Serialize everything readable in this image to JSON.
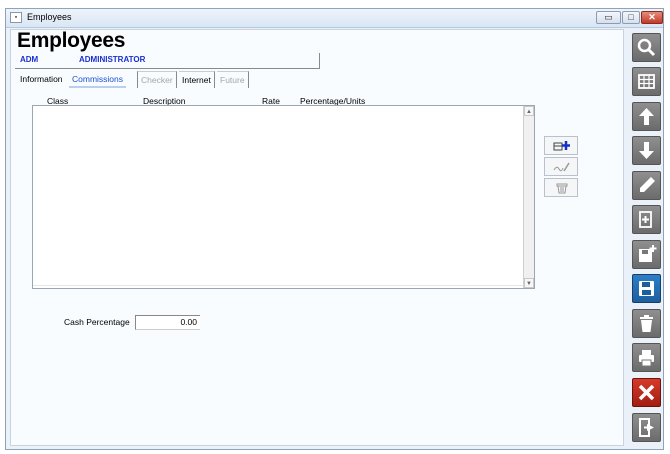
{
  "window": {
    "title": "Employees",
    "icon": "app-icon"
  },
  "heading": "Employees",
  "employee": {
    "code": "ADM",
    "name": "ADMINISTRATOR"
  },
  "tabs": [
    {
      "label": "Information",
      "state": "normal"
    },
    {
      "label": "Commissions",
      "state": "active"
    },
    {
      "label": "Checker",
      "state": "disabled"
    },
    {
      "label": "Internet",
      "state": "normal"
    },
    {
      "label": "Future",
      "state": "disabled"
    }
  ],
  "table": {
    "columns": [
      "Class",
      "Description",
      "Rate",
      "Percentage/Units"
    ],
    "rows": []
  },
  "grid_buttons": [
    "add-row-icon",
    "edit-row-icon",
    "delete-row-icon"
  ],
  "cash": {
    "label": "Cash Percentage",
    "value": "0.00"
  },
  "toolbar": [
    "search-icon",
    "grid-icon",
    "arrow-up-icon",
    "arrow-down-icon",
    "pencil-icon",
    "new-document-icon",
    "save-new-icon",
    "save-icon",
    "trash-icon",
    "print-icon",
    "cancel-icon",
    "exit-icon"
  ],
  "colors": {
    "accent": "#1a2fd0",
    "save": "#1c5f9e",
    "cancel": "#c1271a"
  }
}
